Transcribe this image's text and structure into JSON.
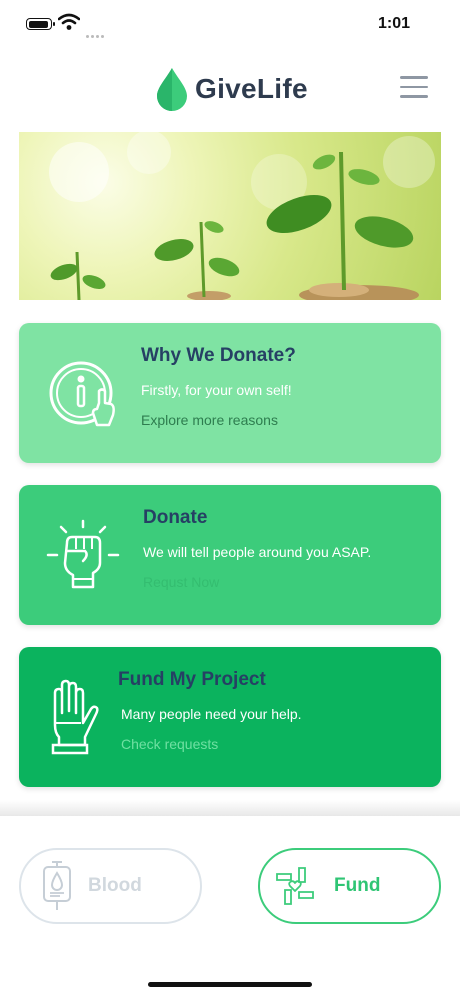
{
  "status_bar": {
    "time": "1:01"
  },
  "header": {
    "app_name": "GiveLife"
  },
  "cards": [
    {
      "title": "Why We Donate?",
      "subtitle": "Firstly, for your own self!",
      "link": "Explore more reasons"
    },
    {
      "title": "Donate",
      "subtitle": "We will tell people around you ASAP.",
      "link": "Requst Now"
    },
    {
      "title": "Fund My Project",
      "subtitle": "Many people need your help.",
      "link": "Check requests"
    }
  ],
  "tabs": [
    {
      "label": "Blood",
      "active": false
    },
    {
      "label": "Fund",
      "active": true
    }
  ],
  "colors": {
    "brand_green": "#3ccc7b",
    "card1_bg": "#7fe3a3",
    "card2_bg": "#3ccc7b",
    "card3_bg": "#0bb35e",
    "title_navy": "#264064",
    "inactive_gray": "#dde4ea"
  },
  "icons": {
    "logo": "water-drop-icon",
    "menu": "hamburger-menu-icon",
    "card1": "info-hand-icon",
    "card2": "raised-fist-icon",
    "card3": "raised-hand-icon",
    "blood_tab": "blood-bag-icon",
    "fund_tab": "helping-hands-heart-icon"
  }
}
